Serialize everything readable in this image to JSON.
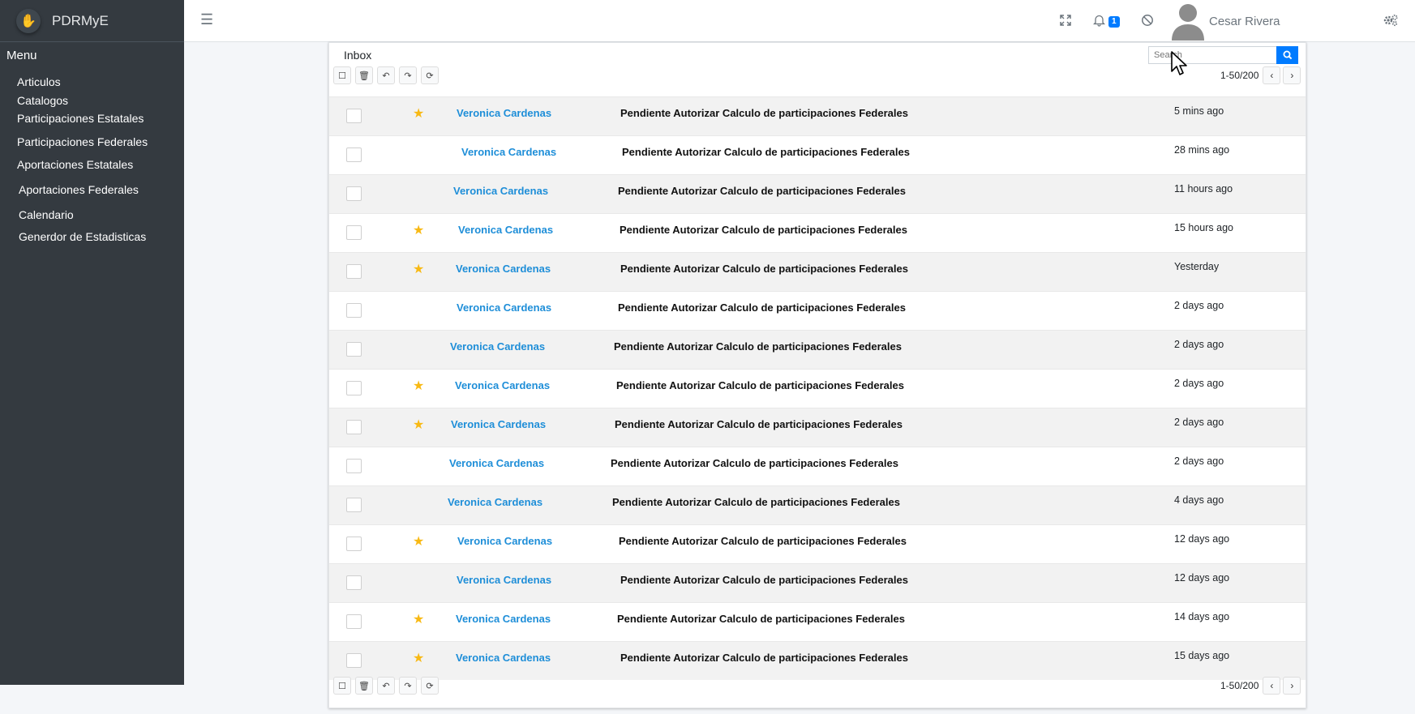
{
  "app": {
    "brand": "PDRMyE"
  },
  "sidebar": {
    "menu_label": "Menu",
    "items": [
      {
        "label": "Articulos"
      },
      {
        "label": "Catalogos"
      },
      {
        "label": "Participaciones Estatales"
      },
      {
        "label": "Participaciones Federales"
      },
      {
        "label": "Aportaciones Estatales"
      },
      {
        "label": "Aportaciones Federales"
      },
      {
        "label": "Calendario"
      },
      {
        "label": "Generdor de Estadisticas"
      }
    ]
  },
  "header": {
    "notifications_count": "1",
    "user_name": "Cesar Rivera",
    "icons": [
      "hamburger-icon",
      "fullscreen-icon",
      "bell-icon",
      "ban-icon",
      "user-avatar",
      "settings-icon"
    ]
  },
  "inbox": {
    "title": "Inbox",
    "search_placeholder": "Search",
    "pagination": "1-50/200",
    "accent_color": "#007bff",
    "sender_color": "#1e8ed8",
    "star_color": "#f8b914",
    "messages": [
      {
        "starred": true,
        "sender": "Veronica Cardenas",
        "subject": "Pendiente Autorizar Calculo de participaciones Federales",
        "time": "5 mins ago"
      },
      {
        "starred": false,
        "sender": "Veronica Cardenas",
        "subject": "Pendiente Autorizar Calculo de participaciones Federales",
        "time": "28 mins ago"
      },
      {
        "starred": false,
        "sender": "Veronica Cardenas",
        "subject": "Pendiente Autorizar Calculo de participaciones Federales",
        "time": "11 hours ago"
      },
      {
        "starred": true,
        "sender": "Veronica Cardenas",
        "subject": "Pendiente Autorizar Calculo de participaciones Federales",
        "time": "15 hours ago"
      },
      {
        "starred": true,
        "sender": "Veronica Cardenas",
        "subject": "Pendiente Autorizar Calculo de participaciones Federales",
        "time": "Yesterday"
      },
      {
        "starred": false,
        "sender": "Veronica Cardenas",
        "subject": "Pendiente Autorizar Calculo de participaciones Federales",
        "time": "2 days ago"
      },
      {
        "starred": false,
        "sender": "Veronica Cardenas",
        "subject": "Pendiente Autorizar Calculo de participaciones Federales",
        "time": "2 days ago"
      },
      {
        "starred": true,
        "sender": "Veronica Cardenas",
        "subject": "Pendiente Autorizar Calculo de participaciones Federales",
        "time": "2 days ago"
      },
      {
        "starred": true,
        "sender": "Veronica Cardenas",
        "subject": "Pendiente Autorizar Calculo de participaciones Federales",
        "time": "2 days ago"
      },
      {
        "starred": false,
        "sender": "Veronica Cardenas",
        "subject": "Pendiente Autorizar Calculo de participaciones Federales",
        "time": "2 days ago"
      },
      {
        "starred": false,
        "sender": "Veronica Cardenas",
        "subject": "Pendiente Autorizar Calculo de participaciones Federales",
        "time": "4 days ago"
      },
      {
        "starred": true,
        "sender": "Veronica Cardenas",
        "subject": "Pendiente Autorizar Calculo de participaciones Federales",
        "time": "12 days ago"
      },
      {
        "starred": false,
        "sender": "Veronica Cardenas",
        "subject": "Pendiente Autorizar Calculo de participaciones Federales",
        "time": "12 days ago"
      },
      {
        "starred": true,
        "sender": "Veronica Cardenas",
        "subject": "Pendiente Autorizar Calculo de participaciones Federales",
        "time": "14 days ago"
      },
      {
        "starred": true,
        "sender": "Veronica Cardenas",
        "subject": "Pendiente Autorizar Calculo de participaciones Federales",
        "time": "15 days ago"
      }
    ]
  }
}
